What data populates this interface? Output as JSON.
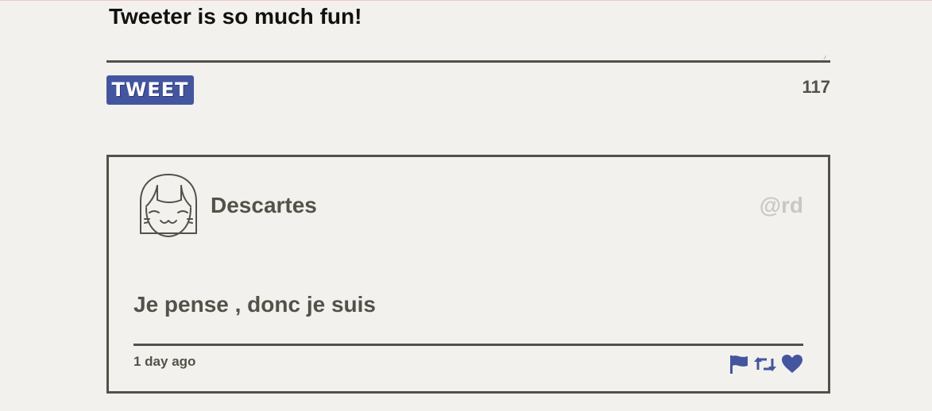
{
  "composer": {
    "text": "Tweeter is so much fun!",
    "button_label": "TWEET",
    "char_counter": "117"
  },
  "tweet": {
    "author_name": "Descartes",
    "handle": "@rd",
    "content": "Je pense , donc je suis",
    "timestamp": "1 day ago",
    "actions": [
      "flag-icon",
      "retweet-icon",
      "heart-icon"
    ]
  },
  "colors": {
    "background": "#f3f1ed",
    "text": "#545149",
    "accent": "#4455a0",
    "handle": "#cbc8c3"
  }
}
